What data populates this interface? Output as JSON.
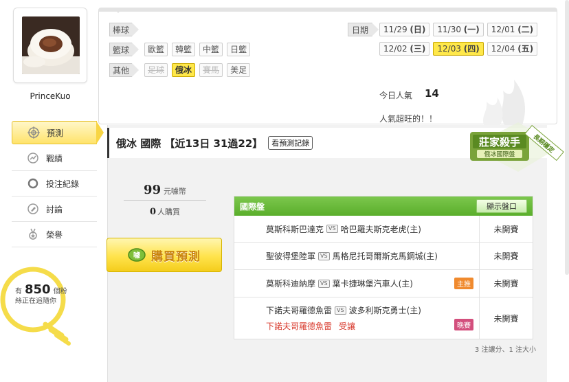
{
  "user": {
    "name": "PrinceKuo",
    "avatar_icon": "steamed-bun-photo"
  },
  "side_nav": [
    {
      "label": "預測",
      "icon": "target-icon",
      "active": true
    },
    {
      "label": "戰績",
      "icon": "chart-icon",
      "active": false
    },
    {
      "label": "投注紀錄",
      "icon": "circle-icon",
      "active": false
    },
    {
      "label": "討論",
      "icon": "pencil-icon",
      "active": false
    },
    {
      "label": "榮譽",
      "icon": "medal-icon",
      "active": false
    }
  ],
  "followers": {
    "prefix": "有",
    "count": "850",
    "suffix": "個粉",
    "line2": "絲正在追隨你"
  },
  "filters": {
    "baseball": {
      "label": "棒球",
      "items": []
    },
    "basketball": {
      "label": "籃球",
      "items": [
        "歐籃",
        "韓籃",
        "中籃",
        "日籃"
      ]
    },
    "other": {
      "label": "其他",
      "items": [
        "足球",
        "俄冰",
        "賽馬",
        "美足"
      ]
    }
  },
  "dates": {
    "label": "日期",
    "items": [
      {
        "text": "11/29 ",
        "day": "(日)",
        "selected": false
      },
      {
        "text": "11/30 ",
        "day": "(一)",
        "selected": false
      },
      {
        "text": "12/01 ",
        "day": "(二)",
        "selected": false
      },
      {
        "text": "12/02 ",
        "day": "(三)",
        "selected": false
      },
      {
        "text": "12/03 ",
        "day": "(四)",
        "selected": true
      },
      {
        "text": "12/04 ",
        "day": "(五)",
        "selected": false
      }
    ]
  },
  "popularity": {
    "label": "今日人氣",
    "value": "14",
    "message": "人氣超旺的！！"
  },
  "prediction": {
    "title": "俄冰 國際 【近13日 31過22】",
    "record_button": "看預測記錄",
    "badge_title": "莊家殺手",
    "badge_sub": "俄冰國際盤",
    "badge_ribbon": "長期穩定"
  },
  "price": {
    "amount": "99",
    "unit": "元噱幣",
    "buyers": "0",
    "buyers_label": "人購買"
  },
  "buy_button": {
    "label": "購買預測",
    "icon_text": "噱"
  },
  "game_table": {
    "title": "國際盤",
    "show_odds": "顯示盤口",
    "vs_text": "VS",
    "rows": [
      {
        "away": "莫斯科斯巴達克",
        "home": "哈巴羅夫斯克老虎(主)",
        "status": "未開賽",
        "tag": "",
        "pick": ""
      },
      {
        "away": "聖彼得堡陸軍",
        "home": "馬格尼托哥爾斯克馬鋼城(主)",
        "status": "未開賽",
        "tag": "",
        "pick": ""
      },
      {
        "away": "莫斯科迪納摩",
        "home": "葉卡捷琳堡汽車人(主)",
        "status": "未開賽",
        "tag": "主推",
        "pick": ""
      },
      {
        "away": "下諾夫哥羅德魚雷",
        "home": "波多利斯克勇士(主)",
        "status": "未開賽",
        "tag": "晚賽",
        "pick": "下諾夫哥羅德魚雷",
        "pick_type": "受讓"
      }
    ],
    "footer": "3 注讓分、1 注大小"
  },
  "colors": {
    "accent_yellow": "#ffe84a",
    "header_green": "#5aae2b",
    "pick_red": "#d83b2e"
  }
}
